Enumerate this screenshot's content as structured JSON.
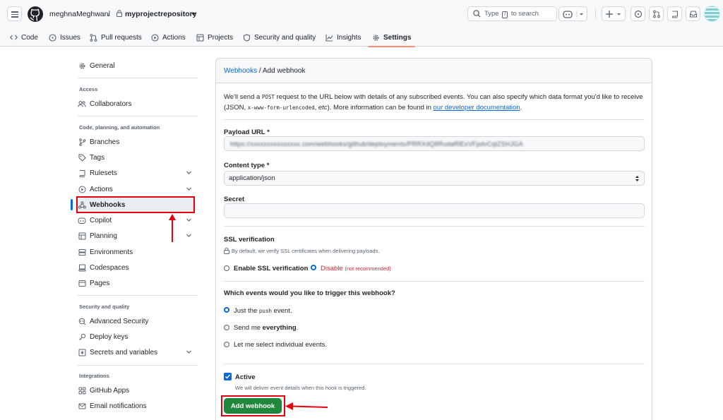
{
  "header": {
    "owner": "meghnaMeghwani",
    "separator": "/",
    "repo": "myprojectrepository",
    "search": {
      "prefix": "Type",
      "key": "/",
      "suffix": "to search"
    }
  },
  "tabs": [
    {
      "label": "Code",
      "icon": "code-icon"
    },
    {
      "label": "Issues",
      "icon": "issue-opened-icon"
    },
    {
      "label": "Pull requests",
      "icon": "git-pull-request-icon"
    },
    {
      "label": "Actions",
      "icon": "play-icon"
    },
    {
      "label": "Projects",
      "icon": "table-icon"
    },
    {
      "label": "Security and quality",
      "icon": "shield-icon"
    },
    {
      "label": "Insights",
      "icon": "graph-icon"
    },
    {
      "label": "Settings",
      "icon": "gear-icon",
      "selected": true
    }
  ],
  "sidebar": {
    "general": "General",
    "access_heading": "Access",
    "collaborators": "Collaborators",
    "code_heading": "Code, planning, and automation",
    "branches": "Branches",
    "tags": "Tags",
    "rulesets": "Rulesets",
    "actions": "Actions",
    "webhooks": "Webhooks",
    "copilot": "Copilot",
    "planning": "Planning",
    "environments": "Environments",
    "codespaces": "Codespaces",
    "pages": "Pages",
    "security_heading": "Security and quality",
    "advanced_security": "Advanced Security",
    "deploy_keys": "Deploy keys",
    "secrets": "Secrets and variables",
    "integrations_heading": "Integrations",
    "github_apps": "GitHub Apps",
    "email_notifications": "Email notifications"
  },
  "form": {
    "breadcrumb_link": "Webhooks",
    "breadcrumb_sep": " / ",
    "breadcrumb_current": "Add webhook",
    "intro_1": "We'll send a ",
    "intro_post": "POST",
    "intro_2": " request to the URL below with details of any subscribed events. You can also specify which data format you'd like to receive (JSON, ",
    "intro_code": "x-www-form-urlencoded",
    "intro_3": ", ",
    "intro_etc": "etc",
    "intro_4": "). More information can be found in ",
    "intro_link": "our developer documentation",
    "intro_5": ".",
    "payload_label": "Payload URL *",
    "payload_value": "https://xxxxxxxxxxxxxxx.com/webhooks/github/deployments/PRRXdQ8RudaRlExVFpdvCqlZSHJGA",
    "content_type_label": "Content type *",
    "content_type_value": "application/json",
    "secret_label": "Secret",
    "ssl_label": "SSL verification",
    "ssl_note": "By default, we verify SSL certificates when delivering payloads.",
    "ssl_enable": "Enable SSL verification",
    "ssl_disable": "Disable",
    "ssl_disable_note": "(not recommended)",
    "events_label": "Which events would you like to trigger this webhook?",
    "event_push_1": "Just the ",
    "event_push_code": "push",
    "event_push_2": " event.",
    "event_all_1": "Send me ",
    "event_all_bold": "everything",
    "event_all_2": ".",
    "event_select": "Let me select individual events.",
    "active_label": "Active",
    "active_note": "We will deliver event details when this hook is triggered.",
    "submit": "Add webhook"
  },
  "colors": {
    "accent": "#0969da",
    "primary_button": "#1f883d",
    "highlight_annotation": "#e3000f",
    "selected_tab_underline": "#fd8c73"
  }
}
